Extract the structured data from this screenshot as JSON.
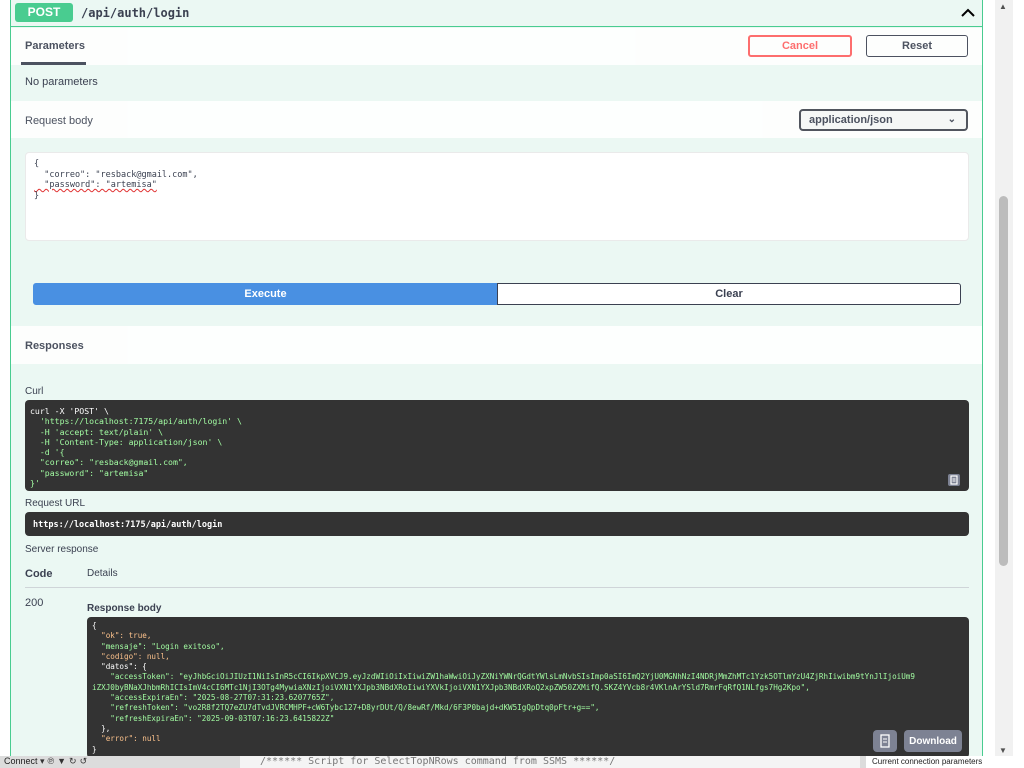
{
  "operation": {
    "method": "POST",
    "path": "/api/auth/login",
    "collapse_icon": "chevron-up-icon"
  },
  "parameters": {
    "tab_label": "Parameters",
    "cancel_label": "Cancel",
    "reset_label": "Reset",
    "empty_text": "No parameters"
  },
  "request_body": {
    "label": "Request body",
    "content_type": "application/json",
    "text_lines": [
      "{",
      "  \"correo\": \"resback@gmail.com\",",
      "  \"password\": \"artemisa\"",
      "}"
    ]
  },
  "actions": {
    "execute_label": "Execute",
    "clear_label": "Clear"
  },
  "responses": {
    "title": "Responses",
    "curl_label": "Curl",
    "curl_lines": [
      "curl -X 'POST' \\",
      "  'https://localhost:7175/api/auth/login' \\",
      "  -H 'accept: text/plain' \\",
      "  -H 'Content-Type: application/json' \\",
      "  -d '{",
      "  \"correo\": \"resback@gmail.com\",",
      "  \"password\": \"artemisa\"",
      "}'"
    ],
    "request_url_label": "Request URL",
    "request_url": "https://localhost:7175/api/auth/login",
    "server_response_label": "Server response",
    "code_header": "Code",
    "details_header": "Details",
    "code": "200",
    "response_body_label": "Response body",
    "response_lines": [
      "{",
      "  \"ok\": true,",
      "  \"mensaje\": \"Login exitoso\",",
      "  \"codigo\": null,",
      "  \"datos\": {",
      "    \"accessToken\": \"eyJhbGciOiJIUzI1NiIsInR5cCI6IkpXVCJ9.eyJzdWIiOiIxIiwiZW1haWwiOiJyZXNiYWNrQGdtYWlsLmNvbSIsImp0aSI6ImQ2YjU0MGNhNzI4NDRjMmZhMTc1Yzk5OTlmYzU4ZjRhIiwibm9tYnJlIjoiUm9",
      "iZXJ0byBNaXJhbmRhICIsImV4cCI6MTc1NjI3OTg4MywiaXNzIjoiVXN1YXJpb3NBdXRoIiwiYXVkIjoiVXN1YXJpb3NBdXRoQ2xpZW50ZXMifQ.SKZ4YVcb8r4VKlnArYSld7RmrFqRfQ1NLfgs7Hg2Kpo\",",
      "    \"accessExpiraEn\": \"2025-08-27T07:31:23.6207765Z\",",
      "    \"refreshToken\": \"vo2R8f2TQ7eZU7dTvdJVRCMHPF+cW6Tybc127+D8yrDUt/Q/8ewRf/Mkd/6F3P0bajd+dKW5IgQpDtq0pFtr+g==\",",
      "    \"refreshExpiraEn\": \"2025-09-03T07:16:23.6415822Z\"",
      "  },",
      "  \"error\": null",
      "}"
    ],
    "download_label": "Download",
    "copy_icon": "clipboard-icon"
  },
  "taskbar": {
    "connect_label": "Connect",
    "script_text": "/****** Script for SelectTopNRows command from SSMS  ******/",
    "status_text": "Current connection parameters"
  },
  "colors": {
    "post_green": "#49cc90",
    "op_background": "#ebf8f3",
    "execute_blue": "#4990e2",
    "cancel_red": "#ff6060",
    "code_background": "#333333",
    "string_green": "#a2fca2",
    "keyword_orange": "#fcc28c"
  }
}
